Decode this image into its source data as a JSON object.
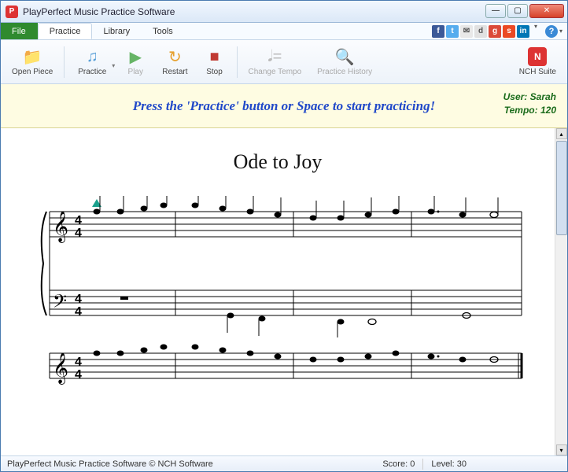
{
  "window": {
    "title": "PlayPerfect Music Practice Software"
  },
  "menu": {
    "file": "File",
    "practice": "Practice",
    "library": "Library",
    "tools": "Tools"
  },
  "toolbar": {
    "open_piece": "Open Piece",
    "practice": "Practice",
    "play": "Play",
    "restart": "Restart",
    "stop": "Stop",
    "change_tempo": "Change Tempo",
    "practice_history": "Practice History",
    "nch_suite": "NCH Suite"
  },
  "banner": {
    "message": "Press the 'Practice' button or Space to start practicing!",
    "user_label": "User:",
    "user_value": "Sarah",
    "tempo_label": "Tempo:",
    "tempo_value": "120"
  },
  "score": {
    "title": "Ode to Joy",
    "time_sig_num": "4",
    "time_sig_den": "4"
  },
  "status": {
    "app": "PlayPerfect Music Practice Software © NCH Software",
    "score_label": "Score:",
    "score_value": "0",
    "level_label": "Level:",
    "level_value": "30"
  },
  "social_icons": [
    {
      "name": "facebook-icon",
      "bg": "#3b5998",
      "t": "f"
    },
    {
      "name": "twitter-icon",
      "bg": "#55acee",
      "t": "t"
    },
    {
      "name": "email-icon",
      "bg": "#e8e8e8",
      "t": "✉"
    },
    {
      "name": "digg-icon",
      "bg": "#e1e1e1",
      "t": "d"
    },
    {
      "name": "google-icon",
      "bg": "#db4a39",
      "t": "g"
    },
    {
      "name": "stumble-icon",
      "bg": "#eb4924",
      "t": "s"
    },
    {
      "name": "linkedin-icon",
      "bg": "#0077b5",
      "t": "in"
    }
  ]
}
